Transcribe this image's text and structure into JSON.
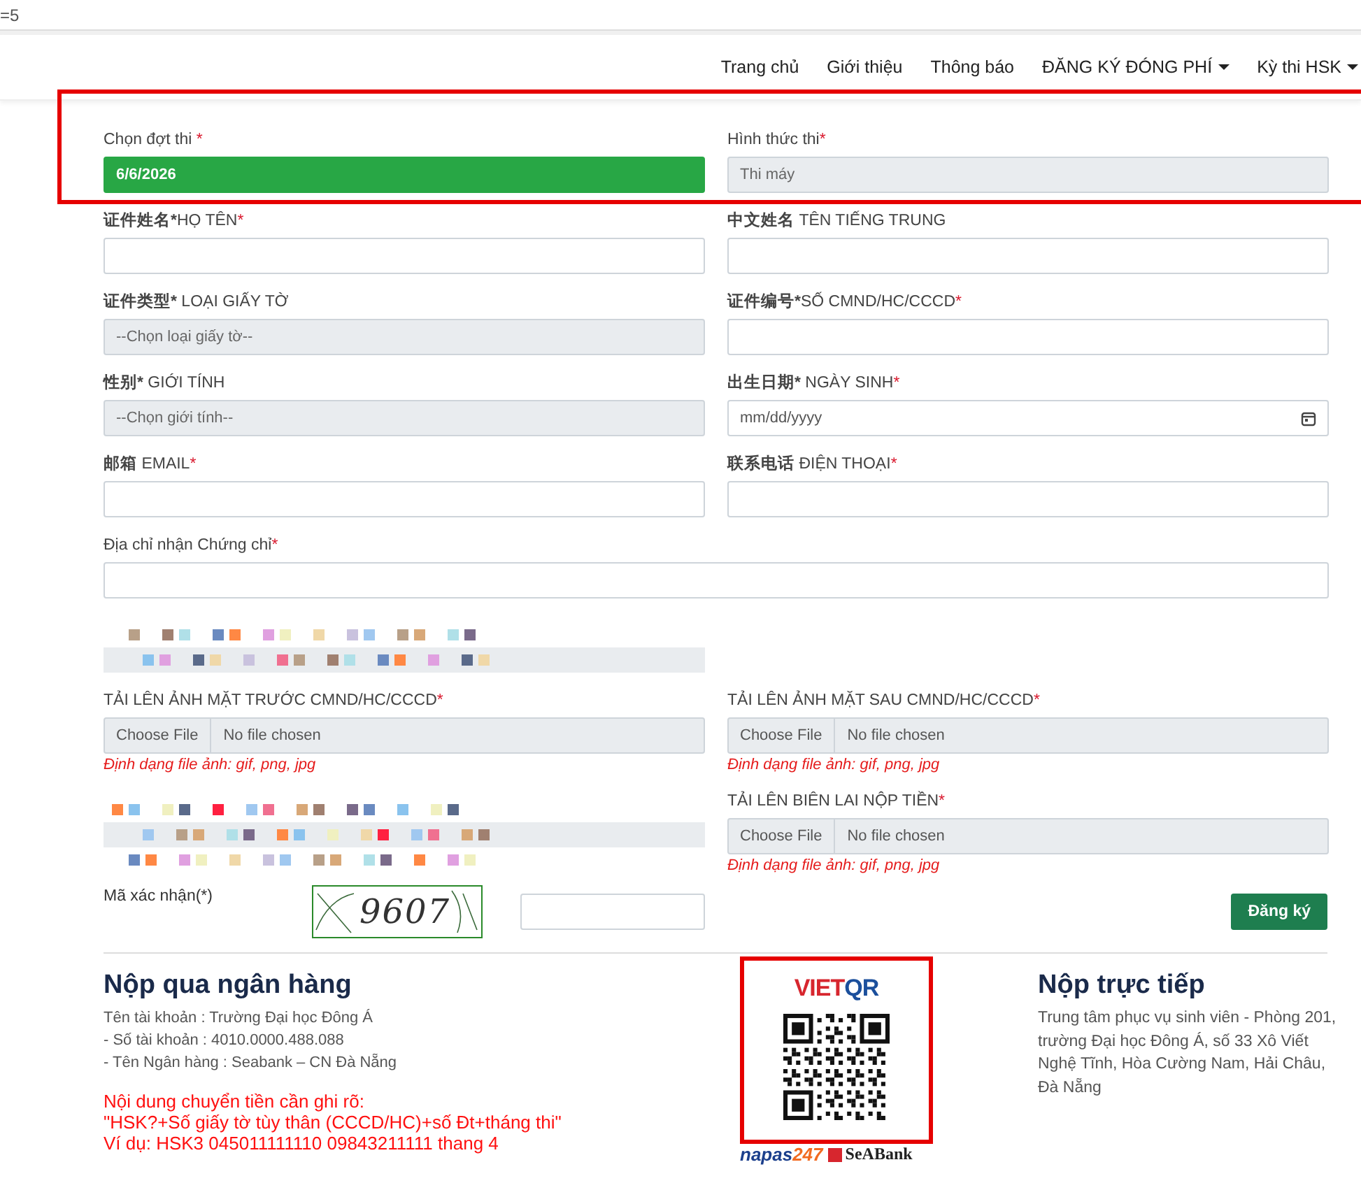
{
  "address_bar": {
    "text": "=5"
  },
  "nav": [
    {
      "label": "Trang chủ",
      "dropdown": false
    },
    {
      "label": "Giới thiệu",
      "dropdown": false
    },
    {
      "label": "Thông báo",
      "dropdown": false
    },
    {
      "label": "ĐĂNG KÝ ĐÓNG PHÍ",
      "dropdown": true
    },
    {
      "label": "Kỳ thi HSK",
      "dropdown": true
    }
  ],
  "fields": [
    {
      "kind": "select-filled",
      "label": {
        "text": "Chọn đợt thi ",
        "star": "*"
      },
      "value": "6/6/2026"
    },
    {
      "kind": "readonly",
      "label": {
        "text": "Hình thức thi",
        "star": "*"
      },
      "value": "Thi máy"
    },
    {
      "kind": "text",
      "label": {
        "zh": "证件姓名*",
        "text": "HỌ TÊN",
        "star": "*"
      }
    },
    {
      "kind": "text",
      "label": {
        "zh": "中文姓名",
        "text": " TÊN TIẾNG TRUNG"
      }
    },
    {
      "kind": "select",
      "label": {
        "zh": "证件类型*",
        "text": " LOẠI GIẤY TỜ"
      },
      "placeholder": "--Chọn loại giấy tờ--"
    },
    {
      "kind": "text",
      "label": {
        "zh": "证件编号*",
        "text": "SỐ CMND/HC/CCCD",
        "star": "*"
      }
    },
    {
      "kind": "select",
      "label": {
        "zh": "性别*",
        "text": " GIỚI TÍNH"
      },
      "placeholder": "--Chọn giới tính--"
    },
    {
      "kind": "date",
      "label": {
        "zh": "出生日期*",
        "text": " NGÀY SINH",
        "star": "*"
      },
      "placeholder": "mm/dd/yyyy"
    },
    {
      "kind": "text",
      "label": {
        "zh": "邮箱",
        "text": " EMAIL",
        "star": "*"
      }
    },
    {
      "kind": "text",
      "label": {
        "zh": "联系电话",
        "text": " ĐIỆN THOẠI",
        "star": "*"
      }
    },
    {
      "kind": "text",
      "wide": true,
      "label": {
        "text": "Địa chỉ nhận Chứng chỉ",
        "star": "*"
      }
    },
    {
      "kind": "redacted",
      "wide": true
    },
    {
      "kind": "file",
      "label": {
        "text": "TẢI LÊN ẢNH MẶT TRƯỚC CMND/HC/CCCD",
        "star": "*"
      },
      "button": "Choose File",
      "status": "No file chosen",
      "hint": "Định dạng file ảnh: gif, png, jpg"
    },
    {
      "kind": "file",
      "label": {
        "text": "TẢI LÊN ẢNH MẶT SAU CMND/HC/CCCD",
        "star": "*"
      },
      "button": "Choose File",
      "status": "No file chosen",
      "hint": "Định dạng file ảnh: gif, png, jpg"
    },
    {
      "kind": "redacted"
    },
    {
      "kind": "file",
      "label": {
        "text": "TẢI LÊN BIÊN LAI NỘP TIỀN",
        "star": "*"
      },
      "button": "Choose File",
      "status": "No file chosen",
      "hint": "Định dạng file ảnh: gif, png, jpg"
    }
  ],
  "captcha": {
    "label": "Mã xác nhận(*)",
    "code": "9607",
    "button": "Đăng ký"
  },
  "bank": {
    "title": "Nộp qua ngân hàng",
    "lines": [
      "Tên tài khoản : Trường Đại học Đông Á",
      "- Số tài khoản : 4010.0000.488.088",
      "- Tên Ngân hàng : Seabank – CN Đà Nẵng"
    ],
    "note_lines": [
      "Nội dung chuyển tiền cần ghi rõ:",
      "\"HSK?+Số giấy tờ tùy thân (CCCD/HC)+số Đt+tháng thi\"",
      "Ví dụ: HSK3 045011111110 09843211111 thang 4"
    ]
  },
  "qr": {
    "logo_red": "VIET",
    "logo_blue": "QR",
    "napas": "napas",
    "napas_num": "247",
    "bank": "SeABank"
  },
  "direct": {
    "title": "Nộp trực tiếp",
    "text": "Trung tâm phục vụ sinh viên - Phòng 201, trường Đại học Đông Á, số 33 Xô Viết Nghệ Tĩnh, Hòa Cường Nam, Hải Châu, Đà Nẵng"
  }
}
